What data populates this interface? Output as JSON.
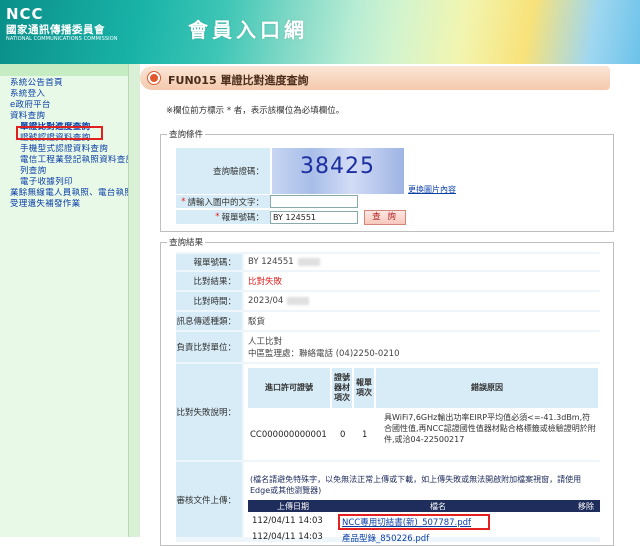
{
  "header": {
    "logo_text": "NCC",
    "logo_zh": "國家通訊傳播委員會",
    "logo_en": "NATIONAL COMMUNICATIONS COMMISSION",
    "site_title": "會員入口網"
  },
  "sidebar": {
    "items": [
      "系統公告首頁",
      "系統登入",
      "e政府平台",
      "資料查詢",
      "單證比對進度查詢",
      "證號認證資料查詢",
      "手機型式認證資料查詢",
      "電信工程業登記執照資料查詢",
      "列查詢",
      "電子收據列印",
      "業餘無線電人員執照、電台執照期滿換發作業",
      "受理遺失補發作業"
    ]
  },
  "page": {
    "title": "FUN015 單證比對進度查詢",
    "note": "※欄位前方標示 * 者，表示該欄位為必填欄位。"
  },
  "query": {
    "legend": "查詢條件",
    "captcha_label": "查詢驗證碼：",
    "captcha_value": "38425",
    "refresh_label": "更換圖片內容",
    "input_captcha_label": "請輸入圖中的文字：",
    "declaration_label": "報單號碼：",
    "declaration_value": "BY 124551",
    "submit_label": "查 詢"
  },
  "result": {
    "legend": "查詢結果",
    "rows": [
      {
        "label": "報單號碼：",
        "value": "BY 124551"
      },
      {
        "label": "比對結果：",
        "value": "比對失敗"
      },
      {
        "label": "比對時間：",
        "value": "2023/04"
      },
      {
        "label": "訊息傳遞種類：",
        "value": "駁貨"
      },
      {
        "label": "負責比對單位：",
        "value": "人工比對",
        "value2": "中區監理處：聯絡電話 (04)2250-0210"
      }
    ],
    "fail_label": "比對失敗說明：",
    "fail_table": {
      "headers": [
        "進口許可證號",
        "證號器材項次",
        "報單項次",
        "錯誤原因"
      ],
      "row": [
        "CC000000000001",
        "0",
        "1",
        "具WiFi7,6GHz輸出功率EIRP平均值必須<=-41.3dBm,符合國性值,再NCC認證國性值器材點合格標籤或檢驗證明於附件,或洽04-22500217"
      ]
    },
    "upload_label": "審核文件上傳：",
    "upload_note": "(檔名請避免特殊字，以免無法正常上傳或下載，如上傳失敗或無法開啟附加檔案視窗，請使用Edge或其他瀏覽器)",
    "upload_headers": [
      "上傳日期",
      "檔名",
      "移除"
    ],
    "files": [
      {
        "date": "112/04/11 14:03",
        "name": "NCC專用切結書(新)_507787.pdf"
      },
      {
        "date": "112/04/11 14:03",
        "name": "產品型錄_850226.pdf"
      }
    ]
  }
}
